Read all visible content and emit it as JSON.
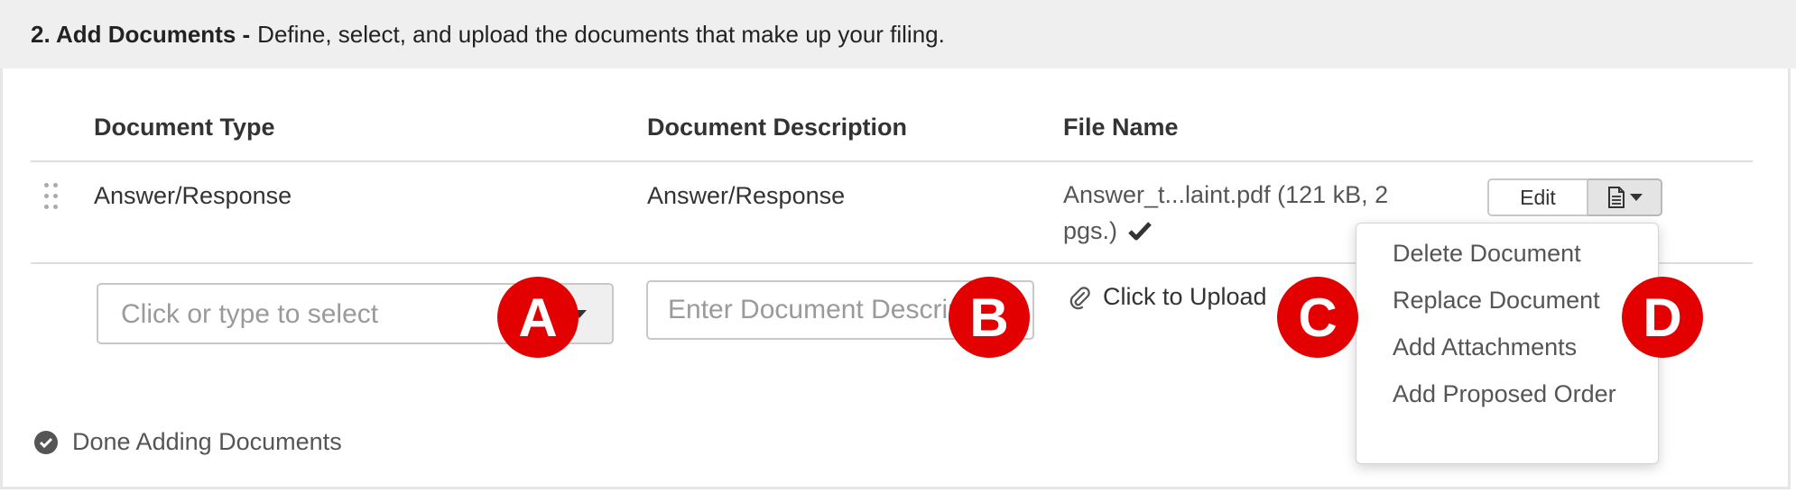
{
  "header": {
    "step_title": "2. Add Documents -",
    "step_description": "Define, select, and upload the documents that make up your filing."
  },
  "table": {
    "columns": [
      "Document Type",
      "Document Description",
      "File Name"
    ],
    "rows": [
      {
        "document_type": "Answer/Response",
        "document_description": "Answer/Response",
        "file_name": "Answer_t...laint.pdf (121 kB, 2 pgs.)",
        "actions": {
          "edit_label": "Edit"
        }
      }
    ]
  },
  "new_row": {
    "type_placeholder": "Click or type to select",
    "description_placeholder": "Enter Document Description",
    "upload_label": "Click to Upload"
  },
  "dropdown_menu": {
    "items": [
      "Delete Document",
      "Replace Document",
      "Add Attachments",
      "Add Proposed Order"
    ]
  },
  "footer": {
    "done_label": "Done Adding Documents"
  },
  "annotations": [
    "A",
    "B",
    "C",
    "D"
  ],
  "colors": {
    "annotation": "#e30000",
    "header_bg": "#efefef",
    "text": "#333333"
  }
}
